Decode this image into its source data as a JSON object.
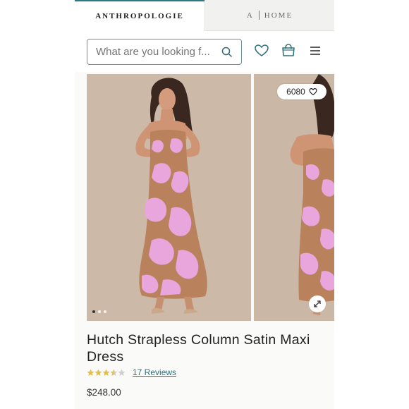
{
  "tabs": {
    "brand_label": "ANTHROPOLOGIE",
    "home_prefix": "A",
    "home_label": "HOME"
  },
  "search": {
    "placeholder": "What are you looking f..."
  },
  "icons": {
    "search": "search-icon",
    "wishlist": "heart-icon",
    "bag": "shopping-bag-icon",
    "menu": "hamburger-menu-icon",
    "expand": "expand-arrows-icon"
  },
  "gallery": {
    "favorites_count": "6080",
    "dots_total": 3,
    "dots_active": 1
  },
  "product": {
    "name": "Hutch Strapless Column Satin Maxi Dress",
    "rating": 3.5,
    "rating_max": 5,
    "reviews_label": "17 Reviews",
    "price": "$248.00"
  },
  "colors": {
    "accent": "#2f6f7a",
    "star": "#e3bf4a",
    "star_empty": "#cfcfcf",
    "dress_base": "#b9825c",
    "dress_print": "#e8a6dd"
  }
}
